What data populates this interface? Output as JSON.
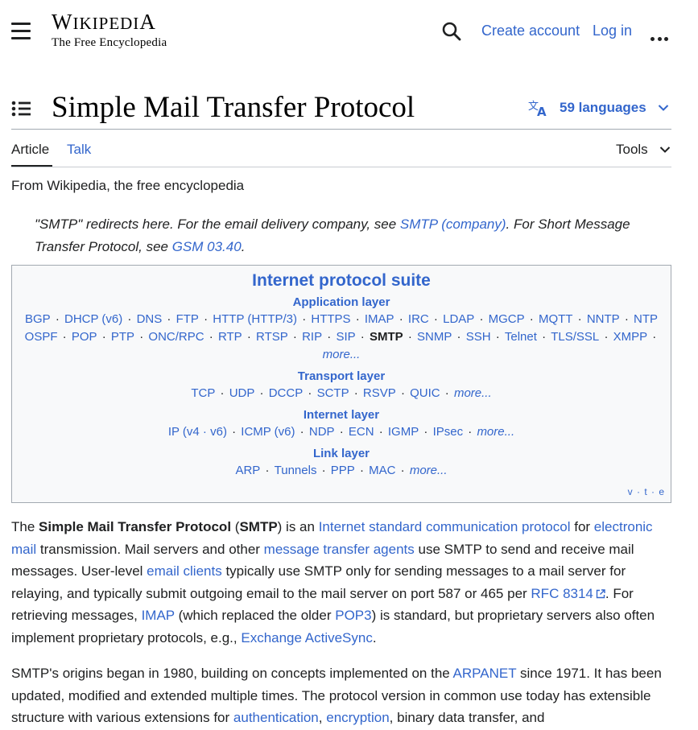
{
  "header": {
    "logo_word": "Wikipedia",
    "logo_tagline": "The Free Encyclopedia",
    "create_account": "Create account",
    "log_in": "Log in"
  },
  "article": {
    "title": "Simple Mail Transfer Protocol",
    "languages": "59 languages",
    "tabs": {
      "article": "Article",
      "talk": "Talk",
      "tools": "Tools"
    },
    "from": "From Wikipedia, the free encyclopedia"
  },
  "hatnote": {
    "t1": "\"SMTP\" redirects here. For the email delivery company, see ",
    "l1": "SMTP (company)",
    "t2": ". For Short Message Transfer Protocol, see ",
    "l2": "GSM 03.40",
    "t3": "."
  },
  "navbox": {
    "title": "Internet protocol suite",
    "sections": [
      {
        "heading": "Application layer",
        "lines": [
          [
            "BGP",
            "DHCP (v6)",
            "DNS",
            "FTP",
            "HTTP (HTTP/3)",
            "HTTPS",
            "IMAP",
            "IRC",
            "LDAP",
            "MGCP",
            "MQTT",
            "NNTP",
            "NTP"
          ],
          [
            "OSPF",
            "POP",
            "PTP",
            "ONC/RPC",
            "RTP",
            "RTSP",
            "RIP",
            "SIP",
            "SMTP",
            "SNMP",
            "SSH",
            "Telnet",
            "TLS/SSL",
            "XMPP",
            "more..."
          ]
        ]
      },
      {
        "heading": "Transport layer",
        "lines": [
          [
            "TCP",
            "UDP",
            "DCCP",
            "SCTP",
            "RSVP",
            "QUIC",
            "more..."
          ]
        ]
      },
      {
        "heading": "Internet layer",
        "lines": [
          [
            "IP (v4 · v6)",
            "ICMP (v6)",
            "NDP",
            "ECN",
            "IGMP",
            "IPsec",
            "more..."
          ]
        ]
      },
      {
        "heading": "Link layer",
        "lines": [
          [
            "ARP",
            "Tunnels",
            "PPP",
            "MAC",
            "more..."
          ]
        ]
      }
    ],
    "current": "SMTP",
    "vte": "v · t · e"
  },
  "para1": {
    "a": "The ",
    "b": "Simple Mail Transfer Protocol",
    "c": " (",
    "d": "SMTP",
    "e": ") is an ",
    "l1": "Internet standard communication protocol",
    "f": " for ",
    "l2": "electronic mail",
    "g": " transmission. Mail servers and other ",
    "l3": "message transfer agents",
    "h": " use SMTP to send and receive mail messages. User-level ",
    "l4": "email clients",
    "i": " typically use SMTP only for sending messages to a mail server for relaying, and typically submit outgoing email to the mail server on port 587 or 465 per ",
    "l5": "RFC 8314",
    "j": ". For retrieving messages, ",
    "l6": "IMAP",
    "k": " (which replaced the older ",
    "l7": "POP3",
    "m": ") is standard, but proprietary servers also often implement proprietary protocols, e.g., ",
    "l8": "Exchange ActiveSync",
    "n": "."
  },
  "para2": {
    "a": "SMTP's origins began in 1980, building on concepts implemented on the ",
    "l1": "ARPANET",
    "b": " since 1971. It has been updated, modified and extended multiple times. The protocol version in common use today has extensible structure with various extensions for ",
    "l2": "authentication",
    "c": ", ",
    "l3": "encryption",
    "d": ", binary data transfer, and"
  }
}
